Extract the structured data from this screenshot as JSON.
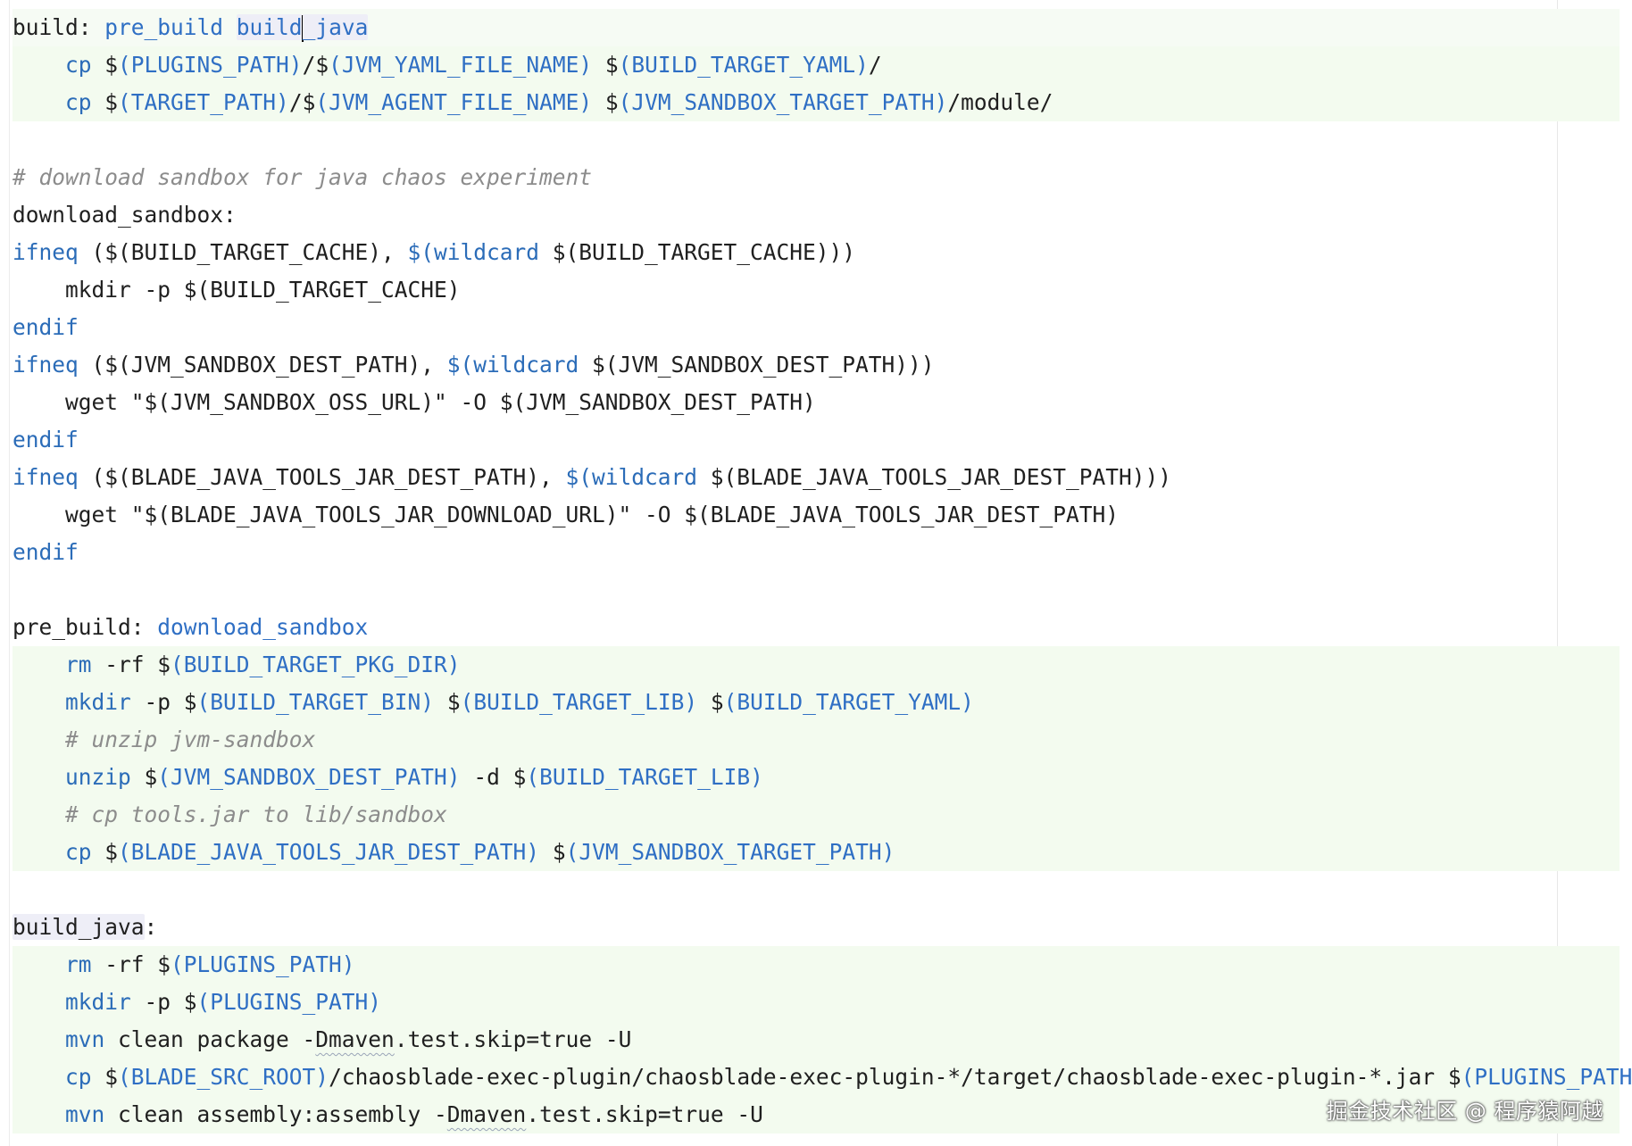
{
  "lines": [
    {
      "band": "top",
      "indent": 0,
      "tokens": [
        {
          "t": "build: ",
          "c": "plain"
        },
        {
          "t": "pre_build",
          "c": "tgt"
        },
        {
          "t": " ",
          "c": "plain"
        },
        {
          "t": "build",
          "c": "tgt",
          "hl": true
        },
        {
          "caret": true
        },
        {
          "t": "_java",
          "c": "tgt",
          "hl": true
        }
      ]
    },
    {
      "band": "green",
      "indent": 1,
      "tokens": [
        {
          "t": "cp",
          "c": "kw"
        },
        {
          "t": " $",
          "c": "plain"
        },
        {
          "t": "(PLUGINS_PATH)",
          "c": "var"
        },
        {
          "t": "/$",
          "c": "plain"
        },
        {
          "t": "(JVM_YAML_FILE_NAME)",
          "c": "var"
        },
        {
          "t": " $",
          "c": "plain"
        },
        {
          "t": "(BUILD_TARGET_YAML)",
          "c": "var"
        },
        {
          "t": "/",
          "c": "plain"
        }
      ]
    },
    {
      "band": "green",
      "indent": 1,
      "tokens": [
        {
          "t": "cp",
          "c": "kw"
        },
        {
          "t": " $",
          "c": "plain"
        },
        {
          "t": "(TARGET_PATH)",
          "c": "var"
        },
        {
          "t": "/$",
          "c": "plain"
        },
        {
          "t": "(JVM_AGENT_FILE_NAME)",
          "c": "var"
        },
        {
          "t": " $",
          "c": "plain"
        },
        {
          "t": "(JVM_SANDBOX_TARGET_PATH)",
          "c": "var"
        },
        {
          "t": "/module/",
          "c": "plain"
        }
      ]
    },
    {
      "band": "none",
      "indent": 0,
      "tokens": []
    },
    {
      "band": "none",
      "indent": 0,
      "tokens": [
        {
          "t": "# download sandbox for java chaos experiment",
          "c": "cmt"
        }
      ]
    },
    {
      "band": "none",
      "indent": 0,
      "tokens": [
        {
          "t": "download_sandbox:",
          "c": "plain"
        }
      ]
    },
    {
      "band": "none",
      "indent": 0,
      "tokens": [
        {
          "t": "ifneq",
          "c": "kw"
        },
        {
          "t": " ($(BUILD_TARGET_CACHE), ",
          "c": "plain"
        },
        {
          "t": "$(wildcard",
          "c": "kw"
        },
        {
          "t": " $(BUILD_TARGET_CACHE)))",
          "c": "plain"
        }
      ]
    },
    {
      "band": "none",
      "indent": 1,
      "tokens": [
        {
          "t": "mkdir -p $(BUILD_TARGET_CACHE)",
          "c": "plain"
        }
      ]
    },
    {
      "band": "none",
      "indent": 0,
      "tokens": [
        {
          "t": "endif",
          "c": "kw"
        }
      ]
    },
    {
      "band": "none",
      "indent": 0,
      "tokens": [
        {
          "t": "ifneq",
          "c": "kw"
        },
        {
          "t": " ($(JVM_SANDBOX_DEST_PATH), ",
          "c": "plain"
        },
        {
          "t": "$(wildcard",
          "c": "kw"
        },
        {
          "t": " $(JVM_SANDBOX_DEST_PATH)))",
          "c": "plain"
        }
      ]
    },
    {
      "band": "none",
      "indent": 1,
      "tokens": [
        {
          "t": "wget \"$(JVM_SANDBOX_OSS_URL)\" -O $(JVM_SANDBOX_DEST_PATH)",
          "c": "plain"
        }
      ]
    },
    {
      "band": "none",
      "indent": 0,
      "tokens": [
        {
          "t": "endif",
          "c": "kw"
        }
      ]
    },
    {
      "band": "none",
      "indent": 0,
      "tokens": [
        {
          "t": "ifneq",
          "c": "kw"
        },
        {
          "t": " ($(BLADE_JAVA_TOOLS_JAR_DEST_PATH), ",
          "c": "plain"
        },
        {
          "t": "$(wildcard",
          "c": "kw"
        },
        {
          "t": " $(BLADE_JAVA_TOOLS_JAR_DEST_PATH)))",
          "c": "plain"
        }
      ]
    },
    {
      "band": "none",
      "indent": 1,
      "tokens": [
        {
          "t": "wget \"$(BLADE_JAVA_TOOLS_JAR_DOWNLOAD_URL)\" -O $(BLADE_JAVA_TOOLS_JAR_DEST_PATH)",
          "c": "plain"
        }
      ]
    },
    {
      "band": "none",
      "indent": 0,
      "tokens": [
        {
          "t": "endif",
          "c": "kw"
        }
      ]
    },
    {
      "band": "none",
      "indent": 0,
      "tokens": []
    },
    {
      "band": "none",
      "indent": 0,
      "tokens": [
        {
          "t": "pre_build: ",
          "c": "plain"
        },
        {
          "t": "download_sandbox",
          "c": "tgt"
        }
      ]
    },
    {
      "band": "green",
      "indent": 1,
      "tokens": [
        {
          "t": "rm",
          "c": "kw"
        },
        {
          "t": " -rf $",
          "c": "plain"
        },
        {
          "t": "(BUILD_TARGET_PKG_DIR)",
          "c": "var"
        }
      ]
    },
    {
      "band": "green",
      "indent": 1,
      "tokens": [
        {
          "t": "mkdir",
          "c": "kw"
        },
        {
          "t": " -p $",
          "c": "plain"
        },
        {
          "t": "(BUILD_TARGET_BIN)",
          "c": "var"
        },
        {
          "t": " $",
          "c": "plain"
        },
        {
          "t": "(BUILD_TARGET_LIB)",
          "c": "var"
        },
        {
          "t": " $",
          "c": "plain"
        },
        {
          "t": "(BUILD_TARGET_YAML)",
          "c": "var"
        }
      ]
    },
    {
      "band": "green",
      "indent": 1,
      "tokens": [
        {
          "t": "# unzip jvm-sandbox",
          "c": "cmt"
        }
      ]
    },
    {
      "band": "green",
      "indent": 1,
      "tokens": [
        {
          "t": "unzip",
          "c": "kw"
        },
        {
          "t": " $",
          "c": "plain"
        },
        {
          "t": "(JVM_SANDBOX_DEST_PATH)",
          "c": "var"
        },
        {
          "t": " -d $",
          "c": "plain"
        },
        {
          "t": "(BUILD_TARGET_LIB)",
          "c": "var"
        }
      ]
    },
    {
      "band": "green",
      "indent": 1,
      "tokens": [
        {
          "t": "# cp tools.jar to lib/sandbox",
          "c": "cmt"
        }
      ]
    },
    {
      "band": "green",
      "indent": 1,
      "tokens": [
        {
          "t": "cp",
          "c": "kw"
        },
        {
          "t": " $",
          "c": "plain"
        },
        {
          "t": "(BLADE_JAVA_TOOLS_JAR_DEST_PATH)",
          "c": "var"
        },
        {
          "t": " $",
          "c": "plain"
        },
        {
          "t": "(JVM_SANDBOX_TARGET_PATH)",
          "c": "var"
        }
      ]
    },
    {
      "band": "none",
      "indent": 0,
      "tokens": []
    },
    {
      "band": "none",
      "indent": 0,
      "tokens": [
        {
          "t": "build_java",
          "c": "plain",
          "hl": true
        },
        {
          "t": ":",
          "c": "plain"
        }
      ]
    },
    {
      "band": "green",
      "indent": 1,
      "tokens": [
        {
          "t": "rm",
          "c": "kw"
        },
        {
          "t": " -rf $",
          "c": "plain"
        },
        {
          "t": "(PLUGINS_PATH)",
          "c": "var"
        }
      ]
    },
    {
      "band": "green",
      "indent": 1,
      "tokens": [
        {
          "t": "mkdir",
          "c": "kw"
        },
        {
          "t": " -p $",
          "c": "plain"
        },
        {
          "t": "(PLUGINS_PATH)",
          "c": "var"
        }
      ]
    },
    {
      "band": "green",
      "indent": 1,
      "tokens": [
        {
          "t": "mvn",
          "c": "kw"
        },
        {
          "t": " clean package -",
          "c": "plain"
        },
        {
          "t": "Dmaven",
          "c": "plain",
          "sq": true
        },
        {
          "t": ".test.skip=true -U",
          "c": "plain"
        }
      ]
    },
    {
      "band": "green",
      "indent": 1,
      "tokens": [
        {
          "t": "cp",
          "c": "kw"
        },
        {
          "t": " $",
          "c": "plain"
        },
        {
          "t": "(BLADE_SRC_ROOT)",
          "c": "var"
        },
        {
          "t": "/chaosblade-exec-plugin/chaosblade-exec-plugin-*/target/chaosblade-exec-plugin-*.jar $",
          "c": "plain"
        },
        {
          "t": "(PLUGINS_PATH)",
          "c": "var"
        }
      ]
    },
    {
      "band": "green",
      "indent": 1,
      "tokens": [
        {
          "t": "mvn",
          "c": "kw"
        },
        {
          "t": " clean assembly:assembly -",
          "c": "plain"
        },
        {
          "t": "Dmaven",
          "c": "plain",
          "sq": true
        },
        {
          "t": ".test.skip=true -U",
          "c": "plain"
        }
      ]
    }
  ],
  "watermark": "掘金技术社区 @ 程序猿阿越"
}
